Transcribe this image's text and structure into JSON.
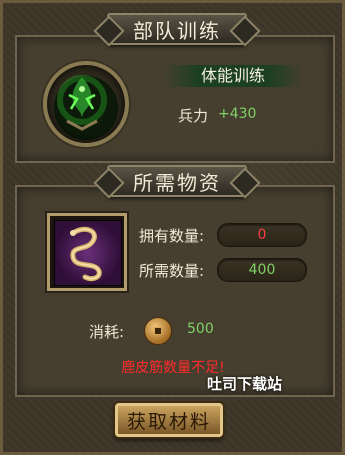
{
  "training": {
    "title": "部队训练",
    "skill_name": "体能训练",
    "troop_label": "兵力",
    "troop_value": "+430"
  },
  "materials": {
    "title": "所需物资",
    "owned_label": "拥有数量:",
    "owned_value": "0",
    "required_label": "所需数量:",
    "required_value": "400",
    "cost_label": "消耗:",
    "cost_value": "500",
    "warning": "鹿皮筋数量不足!",
    "get_button": "获取材料"
  },
  "watermark": "吐司下载站",
  "colors": {
    "value_green": "#7fd266",
    "value_red": "#ff3f3f",
    "warning_red": "#ff2b2b"
  },
  "icons": [
    "training-emblem-icon",
    "deer-tendon-item-icon",
    "copper-coin-icon"
  ]
}
